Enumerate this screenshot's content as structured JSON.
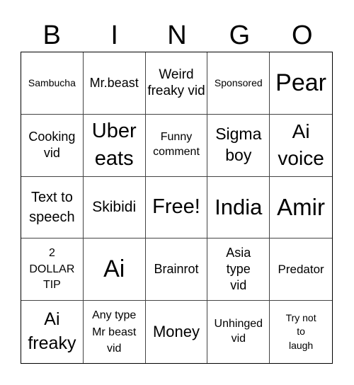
{
  "header": {
    "letters": [
      "B",
      "I",
      "N",
      "G",
      "O"
    ]
  },
  "cells": [
    {
      "text": "Sambucha"
    },
    {
      "text": "Mr.beast"
    },
    {
      "text": "Weird freaky vid"
    },
    {
      "text": "Sponsored"
    },
    {
      "text": "Pear"
    },
    {
      "text": "Cooking vid"
    },
    {
      "text": "Uber eats"
    },
    {
      "text": "Funny comment"
    },
    {
      "text": "Sigma boy"
    },
    {
      "text": "Ai voice"
    },
    {
      "text": "Text to speech"
    },
    {
      "text": "Skibidi"
    },
    {
      "text": "Free!"
    },
    {
      "text": "India"
    },
    {
      "text": "Amir"
    },
    {
      "text": "2 DOLLAR TIP"
    },
    {
      "text": "Ai"
    },
    {
      "text": "Brainrot"
    },
    {
      "text": "Asia type vid"
    },
    {
      "text": "Predator"
    },
    {
      "text": "Ai freaky"
    },
    {
      "text": "Any type Mr beast vid"
    },
    {
      "text": "Money"
    },
    {
      "text": "Unhinged vid"
    },
    {
      "text": "Try not to laugh"
    }
  ]
}
